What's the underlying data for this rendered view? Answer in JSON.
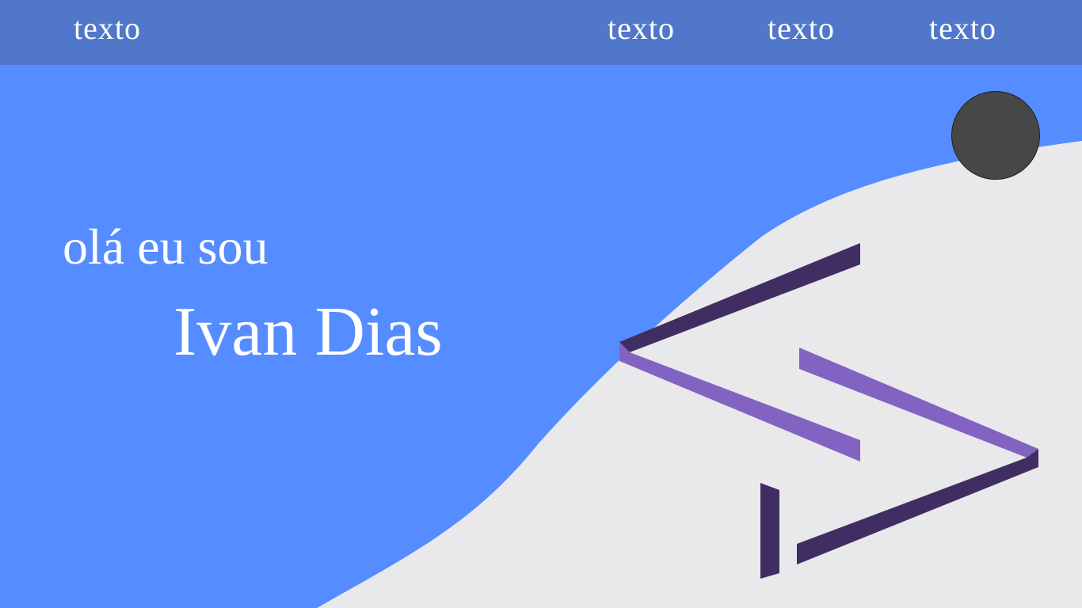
{
  "nav": {
    "brand": "texto",
    "links": [
      "texto",
      "texto",
      "texto"
    ]
  },
  "hero": {
    "greeting": "olá eu sou",
    "name": "Ivan Dias"
  },
  "colors": {
    "hero_background": "#558cff",
    "navbar_background": "#5077c9",
    "wave": "#e9e9ec",
    "logo_dark": "#402e62",
    "logo_light": "#8263c2",
    "avatar": "#474747"
  },
  "icons": {
    "avatar": "avatar-circle",
    "logo": "code-brackets-logo"
  }
}
